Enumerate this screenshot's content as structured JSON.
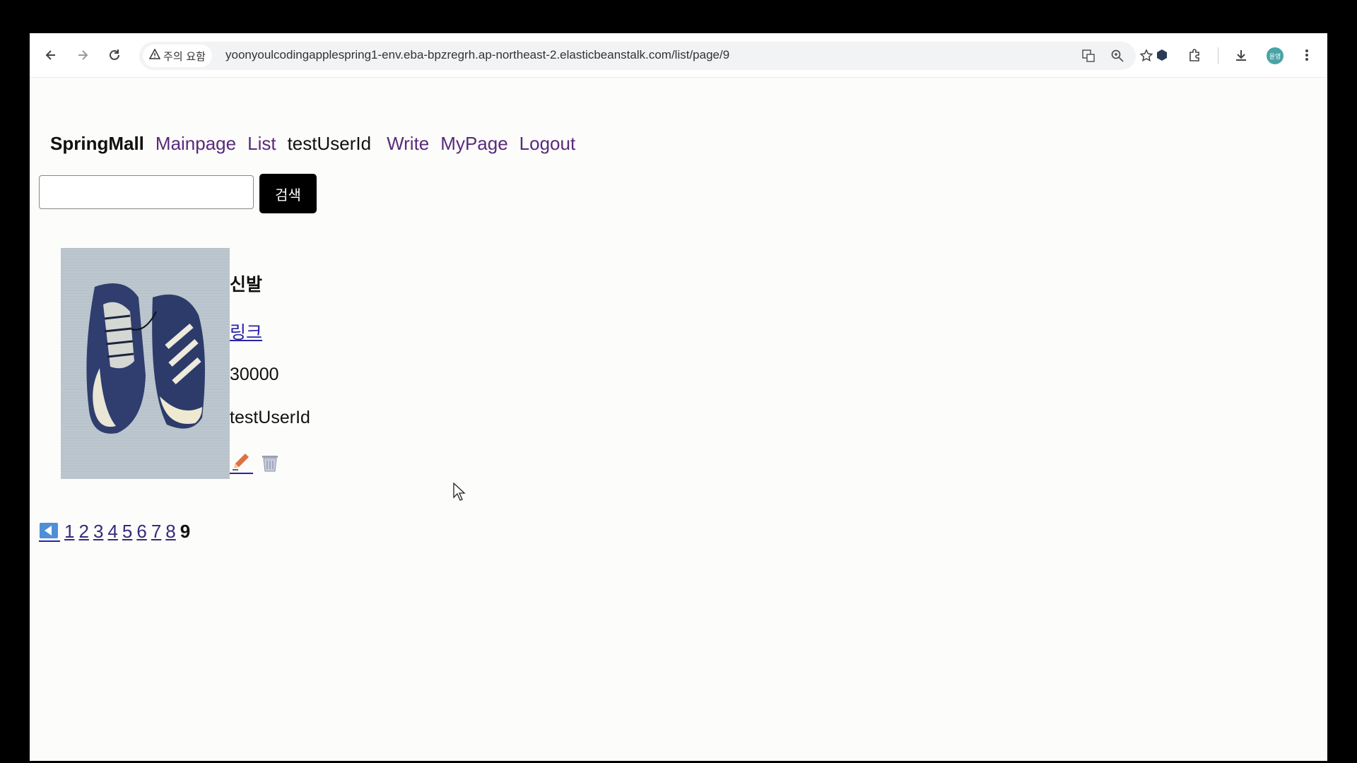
{
  "browser": {
    "security_label": "주의 요함",
    "url": "yoonyoulcodingapplespring1-env.eba-bpzregrh.ap-northeast-2.elasticbeanstalk.com/list/page/9",
    "profile_initials": "윤영"
  },
  "nav": {
    "brand": "SpringMall",
    "mainpage": "Mainpage",
    "list": "List",
    "user": "testUserId",
    "write": "Write",
    "mypage": "MyPage",
    "logout": "Logout"
  },
  "search": {
    "value": "",
    "button_label": "검색"
  },
  "product": {
    "title": "신발",
    "link_text": "링크",
    "price": "30000",
    "owner": "testUserId"
  },
  "pagination": {
    "pages": [
      "1",
      "2",
      "3",
      "4",
      "5",
      "6",
      "7",
      "8"
    ],
    "current": "9"
  }
}
